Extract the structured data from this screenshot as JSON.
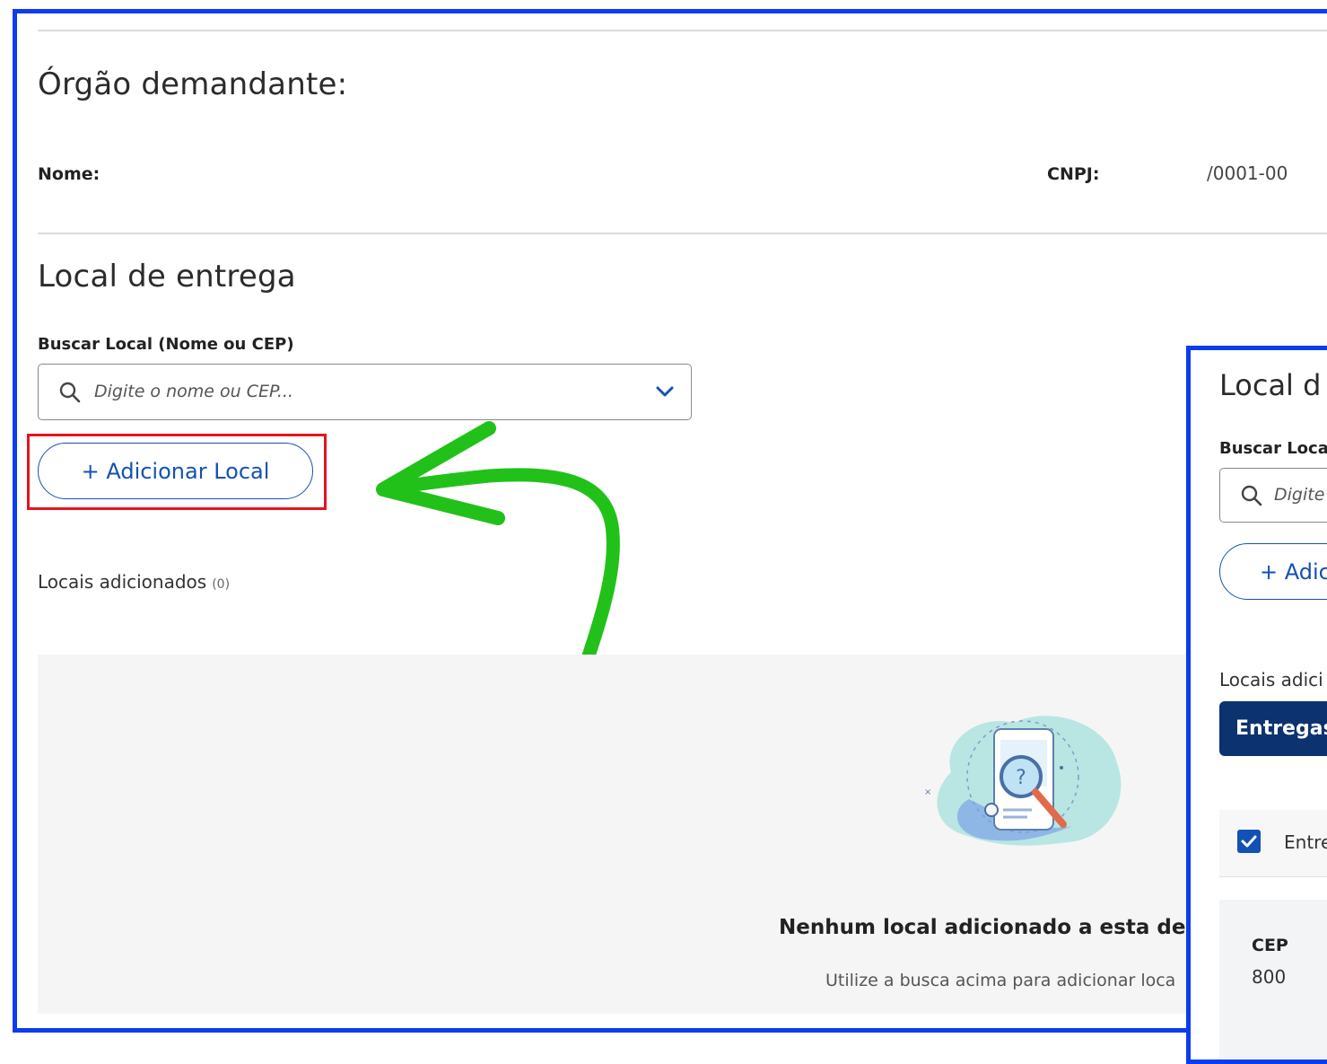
{
  "orgao": {
    "title": "Órgão demandante:",
    "nome_label": "Nome:",
    "cnpj_label": "CNPJ:",
    "cnpj_value": "/0001-00"
  },
  "local": {
    "title": "Local de entrega",
    "search_label": "Buscar Local (Nome ou CEP)",
    "search_placeholder": "Digite o nome ou CEP...",
    "add_button": "+ Adicionar Local",
    "added_label": "Locais adicionados",
    "added_count": "(0)",
    "empty_title": "Nenhum local adicionado a esta den",
    "empty_subtitle": "Utilize a busca acima para adicionar loca"
  },
  "second_view": {
    "title": "Local d",
    "search_label": "Buscar Loca",
    "search_placeholder": "Digite",
    "add_button": "+ Adic",
    "added_label": "Locais adici",
    "tab_button": "Entregas",
    "checkbox_label": "Entre",
    "cep_label": "CEP",
    "cep_value": "800"
  },
  "colors": {
    "frame": "#0b3cf0",
    "primary": "#1351b4",
    "highlight": "#e5141b",
    "arrow": "#22c11a",
    "dark_button": "#0c326f"
  }
}
